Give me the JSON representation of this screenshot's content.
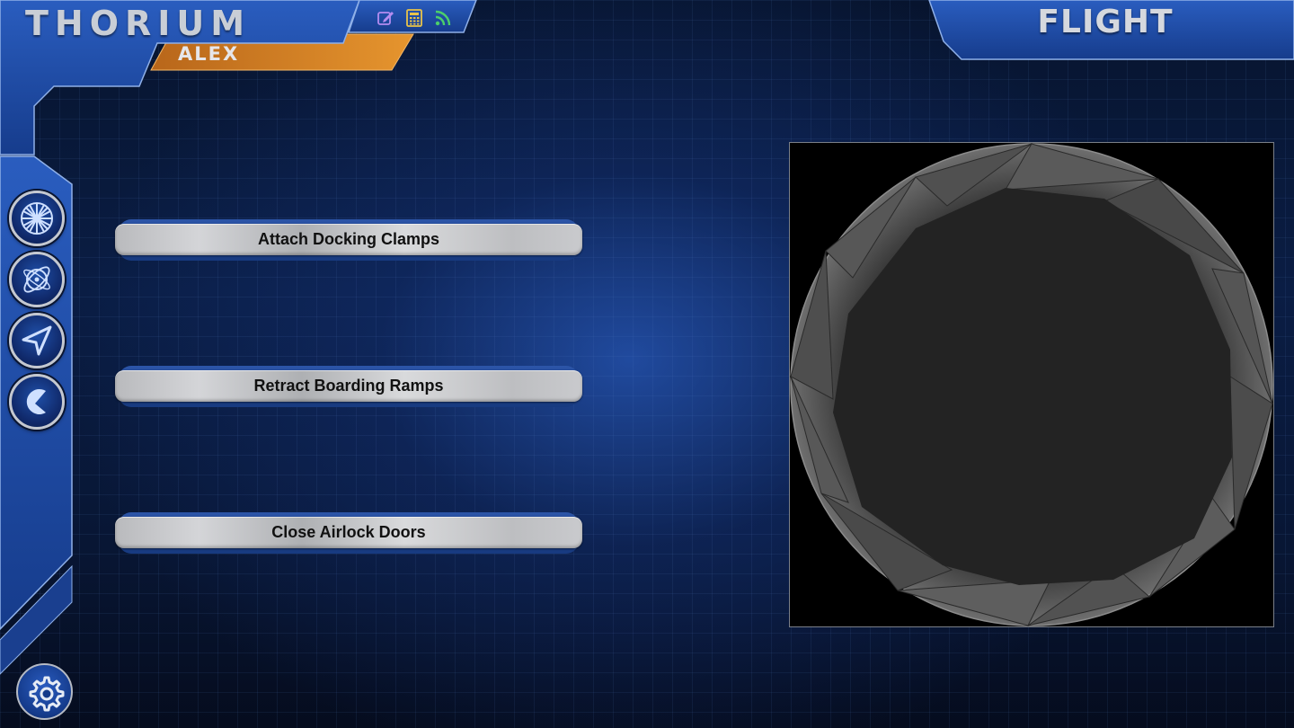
{
  "app": {
    "brand": "THORIUM",
    "user": "ALEX",
    "station": "FLIGHT"
  },
  "top_icons": [
    {
      "name": "edit-icon",
      "color": "#b48cf0"
    },
    {
      "name": "calculator-icon",
      "color": "#e8c34a"
    },
    {
      "name": "rss-feed-icon",
      "color": "#4ccf6a"
    }
  ],
  "nav": [
    {
      "name": "turbine-icon"
    },
    {
      "name": "orbit-icon"
    },
    {
      "name": "navigation-arrow-icon"
    },
    {
      "name": "crescent-icon"
    }
  ],
  "actions": [
    {
      "label": "Attach Docking Clamps"
    },
    {
      "label": "Retract Boarding Ramps"
    },
    {
      "label": "Close Airlock Doors"
    }
  ],
  "viewer": {
    "icon": "airlock-aperture-icon"
  },
  "settings": {
    "icon": "settings-gear-icon"
  },
  "colors": {
    "frame_blue": "#1e4aa6",
    "user_tab_orange": "#d9872a",
    "button_gray": "#c8c9cc"
  }
}
